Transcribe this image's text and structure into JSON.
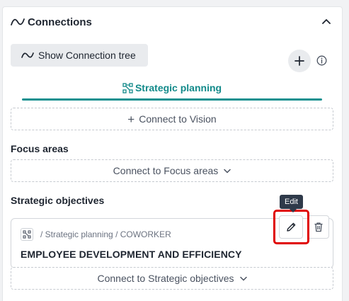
{
  "header": {
    "title": "Connections"
  },
  "toolbar": {
    "tree_button_label": "Show Connection tree"
  },
  "tab": {
    "label": "Strategic planning",
    "accent_color": "#13908f"
  },
  "vision": {
    "connect_label": "Connect to Vision"
  },
  "focus_areas": {
    "heading": "Focus areas",
    "connect_label": "Connect to Focus areas"
  },
  "strategic_objectives": {
    "heading": "Strategic objectives",
    "items": [
      {
        "breadcrumb": "/ Strategic planning / COWORKER",
        "title": "EMPLOYEE DEVELOPMENT AND EFFICIENCY"
      }
    ],
    "connect_label": "Connect to Strategic objectives"
  },
  "tooltip": {
    "label": "Edit"
  },
  "icons": {
    "header": "wave-icon",
    "collapse": "chevron-up-icon",
    "add": "plus-icon",
    "info": "info-icon",
    "tab": "hierarchy-icon",
    "edit": "pencil-icon",
    "delete": "trash-icon"
  },
  "highlight_color": "#e00000"
}
